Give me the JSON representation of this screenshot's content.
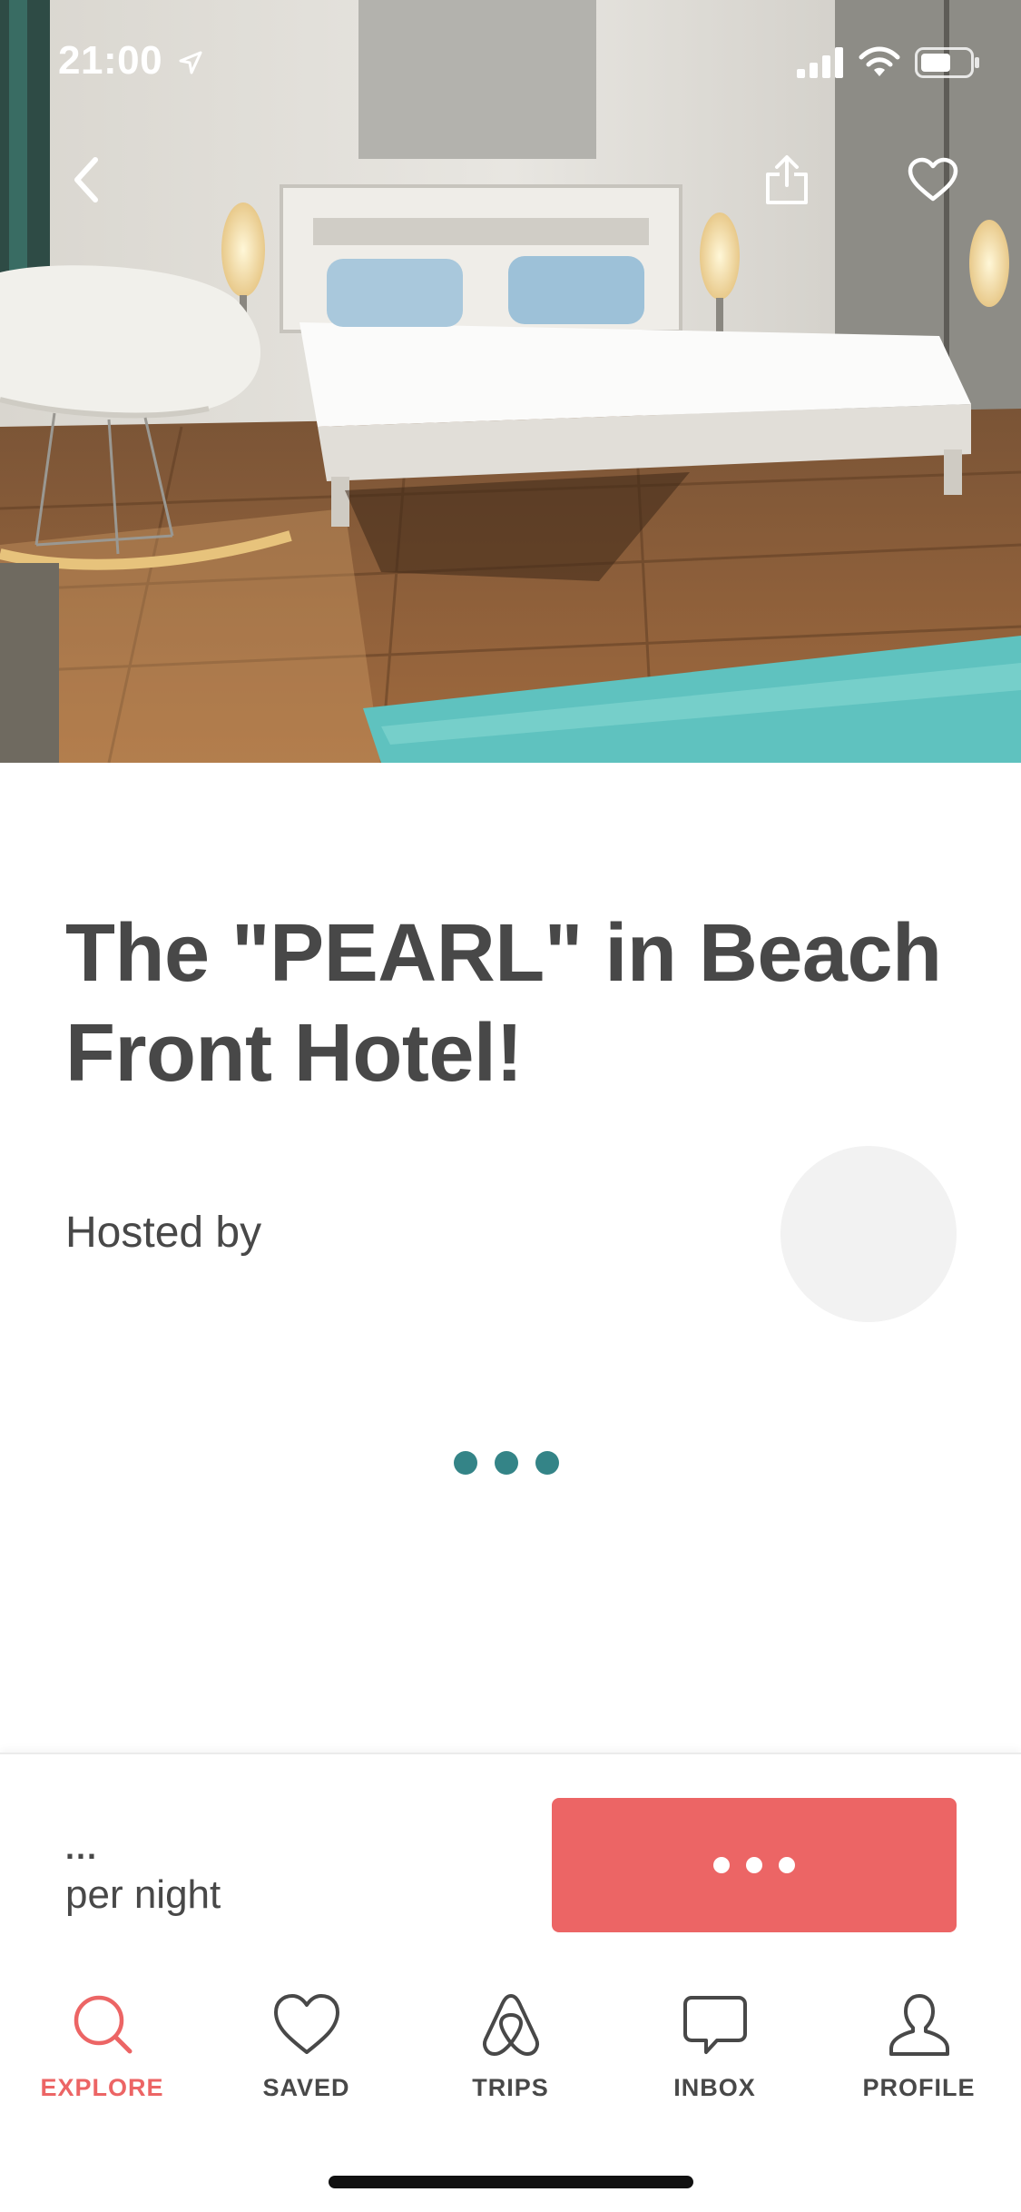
{
  "status_bar": {
    "time": "21:00"
  },
  "listing": {
    "title": "The \"PEARL\" in Beach Front Hotel!",
    "hosted_by_label": "Hosted by"
  },
  "booking": {
    "price": "...",
    "per_night": "per night"
  },
  "tabs": [
    {
      "label": "EXPLORE",
      "icon": "search-icon",
      "active": true
    },
    {
      "label": "SAVED",
      "icon": "heart-icon",
      "active": false
    },
    {
      "label": "TRIPS",
      "icon": "airbnb-logo-icon",
      "active": false
    },
    {
      "label": "INBOX",
      "icon": "message-icon",
      "active": false
    },
    {
      "label": "PROFILE",
      "icon": "person-icon",
      "active": false
    }
  ],
  "colors": {
    "brand": "#ec6565",
    "loader": "#348487",
    "text": "#484848"
  }
}
